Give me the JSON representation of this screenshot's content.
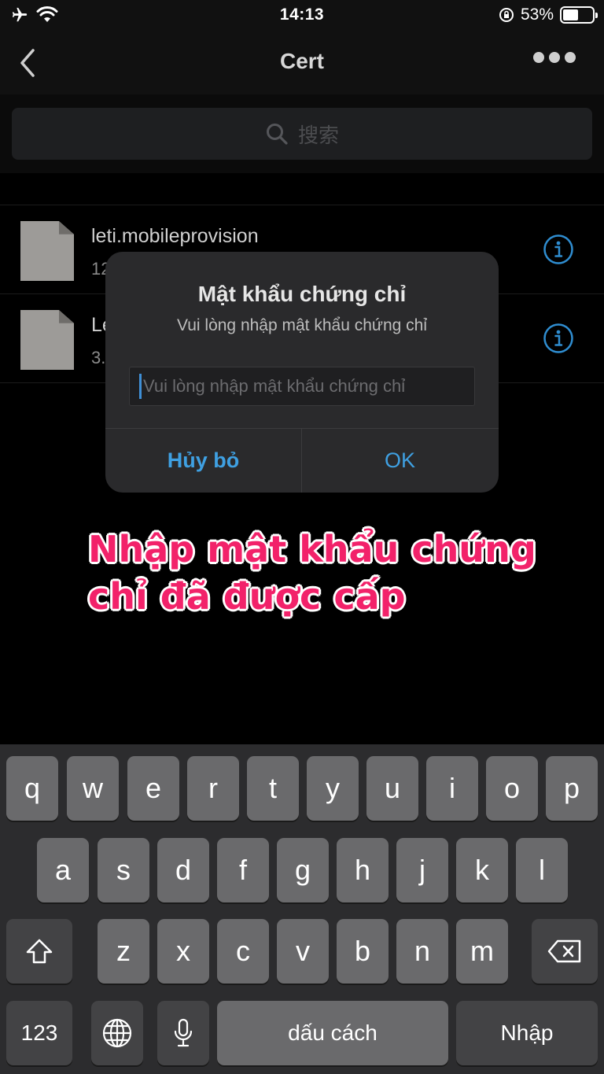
{
  "status_bar": {
    "time": "14:13",
    "battery_text": "53%",
    "battery_level": 0.53,
    "icons": [
      "airplane-icon",
      "wifi-icon",
      "orientation-lock-icon",
      "battery-icon"
    ]
  },
  "nav": {
    "title": "Cert",
    "back_icon": "chevron-left-icon",
    "more_icon": "more-icon"
  },
  "search": {
    "placeholder": "搜索",
    "icon": "search-icon"
  },
  "files": [
    {
      "name": "leti.mobileprovision",
      "size": "12",
      "icon": "file-icon",
      "info_icon": "info-icon"
    },
    {
      "name": "Le",
      "size": "3.",
      "icon": "file-icon",
      "info_icon": "info-icon"
    }
  ],
  "dialog": {
    "title": "Mật khẩu chứng chỉ",
    "message": "Vui lòng nhập mật khẩu chứng chỉ",
    "input_placeholder": "Vui lòng nhập mật khẩu chứng chỉ",
    "input_value": "",
    "cancel_label": "Hủy bỏ",
    "ok_label": "OK",
    "accent_color": "#3fa0e2"
  },
  "caption": {
    "line1": "Nhập mật khẩu chứng",
    "line2": "chỉ đã được cấp",
    "color": "#f2226a"
  },
  "keyboard": {
    "row1": [
      "q",
      "w",
      "e",
      "r",
      "t",
      "y",
      "u",
      "i",
      "o",
      "p"
    ],
    "row2": [
      "a",
      "s",
      "d",
      "f",
      "g",
      "h",
      "j",
      "k",
      "l"
    ],
    "row3": [
      "z",
      "x",
      "c",
      "v",
      "b",
      "n",
      "m"
    ],
    "numbers_label": "123",
    "space_label": "dấu cách",
    "return_label": "Nhập",
    "shift_icon": "shift-icon",
    "delete_icon": "delete-icon",
    "globe_icon": "globe-icon",
    "mic_icon": "microphone-icon"
  }
}
